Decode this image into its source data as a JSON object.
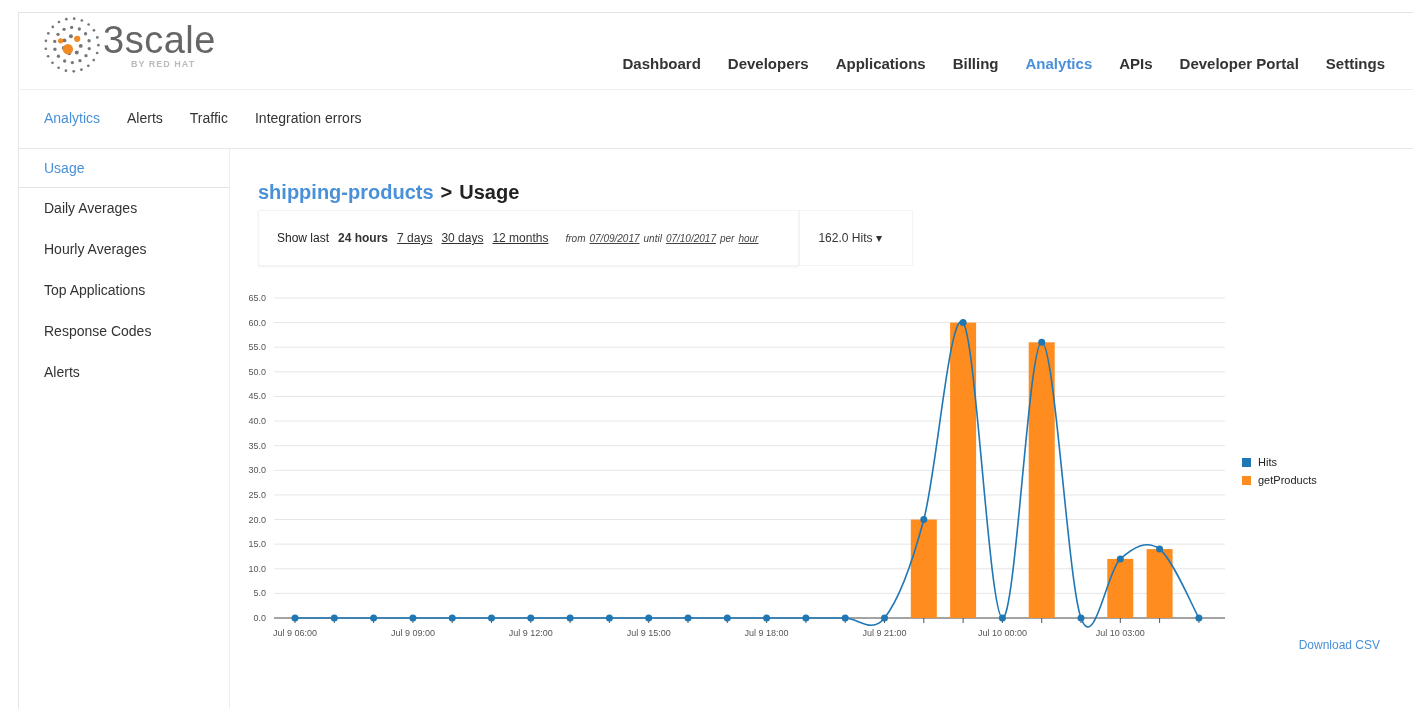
{
  "logo": {
    "name": "3scale",
    "tagline": "BY RED HAT"
  },
  "nav": [
    {
      "label": "Dashboard",
      "selected": false
    },
    {
      "label": "Developers",
      "selected": false
    },
    {
      "label": "Applications",
      "selected": false
    },
    {
      "label": "Billing",
      "selected": false
    },
    {
      "label": "Analytics",
      "selected": true
    },
    {
      "label": "APIs",
      "selected": false
    },
    {
      "label": "Developer Portal",
      "selected": false
    },
    {
      "label": "Settings",
      "selected": false
    }
  ],
  "subnav": [
    {
      "label": "Analytics",
      "selected": true
    },
    {
      "label": "Alerts",
      "selected": false
    },
    {
      "label": "Traffic",
      "selected": false
    },
    {
      "label": "Integration errors",
      "selected": false
    }
  ],
  "sidebar": {
    "items": [
      {
        "label": "Usage",
        "selected": true
      },
      {
        "label": "Daily Averages",
        "selected": false
      },
      {
        "label": "Hourly Averages",
        "selected": false
      },
      {
        "label": "Top Applications",
        "selected": false
      },
      {
        "label": "Response Codes",
        "selected": false
      },
      {
        "label": "Alerts",
        "selected": false
      }
    ]
  },
  "breadcrumb": {
    "service": "shipping-products",
    "separator": ">",
    "page": "Usage"
  },
  "filter": {
    "prefix": "Show last",
    "periods": [
      {
        "label": "24 hours",
        "selected": true
      },
      {
        "label": "7 days",
        "selected": false
      },
      {
        "label": "30 days",
        "selected": false
      },
      {
        "label": "12 months",
        "selected": false
      }
    ],
    "from_label": "from",
    "from": "07/09/2017",
    "until_label": "until",
    "until": "07/10/2017",
    "per_label": "per",
    "per": "hour"
  },
  "metric_dropdown": {
    "value": "162.0 Hits",
    "caret": "▾"
  },
  "chart": {
    "chart_data": {
      "type": "bar",
      "categories": [
        "Jul 9 06:00",
        null,
        null,
        "Jul 9 09:00",
        null,
        null,
        "Jul 9 12:00",
        null,
        null,
        "Jul 9 15:00",
        null,
        null,
        "Jul 9 18:00",
        null,
        null,
        "Jul 9 21:00",
        null,
        null,
        "Jul 10 00:00",
        null,
        null,
        "Jul 10 03:00",
        null,
        null
      ],
      "ylim": [
        0,
        65
      ],
      "grid": true,
      "yticks": [
        {
          "value": 0,
          "label": "0.0"
        },
        {
          "value": 5,
          "label": "5.0"
        },
        {
          "value": 10,
          "label": "10.0"
        },
        {
          "value": 15,
          "label": "15.0"
        },
        {
          "value": 20,
          "label": "20.0"
        },
        {
          "value": 25,
          "label": "25.0"
        },
        {
          "value": 30,
          "label": "30.0"
        },
        {
          "value": 35,
          "label": "35.0"
        },
        {
          "value": 40,
          "label": "40.0"
        },
        {
          "value": 45,
          "label": "45.0"
        },
        {
          "value": 50,
          "label": "50.0"
        },
        {
          "value": 55,
          "label": "55.0"
        },
        {
          "value": 60,
          "label": "60.0"
        },
        {
          "value": 65,
          "label": "65.0"
        }
      ],
      "series": [
        {
          "name": "Hits",
          "type": "line",
          "marker": true,
          "color": "#1f77b4",
          "values": [
            0,
            0,
            0,
            0,
            0,
            0,
            0,
            0,
            0,
            0,
            0,
            0,
            0,
            0,
            0,
            0,
            20,
            60,
            0,
            56,
            0,
            12,
            14,
            0
          ]
        },
        {
          "name": "getProducts",
          "type": "bar",
          "color": "#ff8c1f",
          "values": [
            0,
            0,
            0,
            0,
            0,
            0,
            0,
            0,
            0,
            0,
            0,
            0,
            0,
            0,
            0,
            0,
            20,
            60,
            0,
            56,
            0,
            12,
            14,
            0
          ]
        }
      ]
    }
  },
  "download_link": "Download CSV"
}
